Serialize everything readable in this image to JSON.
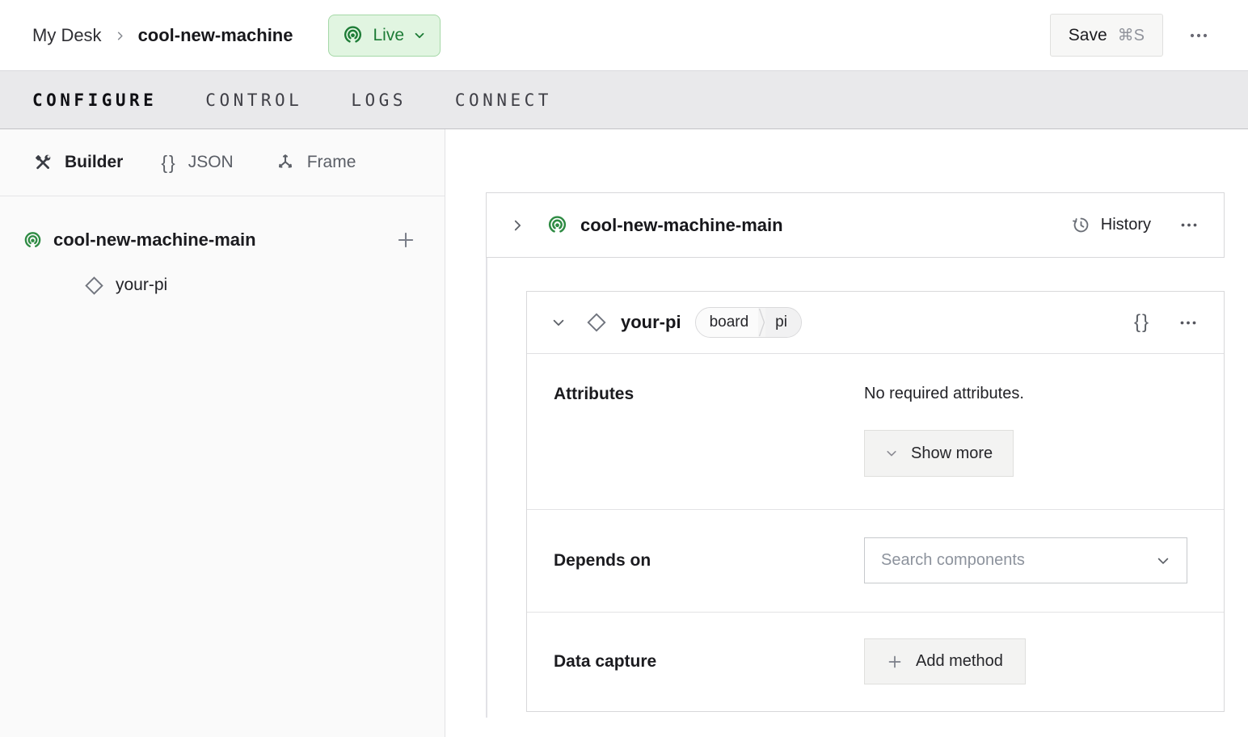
{
  "header": {
    "breadcrumb": {
      "parent": "My Desk",
      "current": "cool-new-machine"
    },
    "status": {
      "label": "Live"
    },
    "save": {
      "label": "Save",
      "shortcut": "⌘S"
    }
  },
  "tabs": [
    {
      "label": "CONFIGURE",
      "active": true
    },
    {
      "label": "CONTROL",
      "active": false
    },
    {
      "label": "LOGS",
      "active": false
    },
    {
      "label": "CONNECT",
      "active": false
    }
  ],
  "sidebar": {
    "view_modes": [
      {
        "label": "Builder",
        "icon": "tools-icon",
        "active": true
      },
      {
        "label": "JSON",
        "icon": "braces-icon",
        "active": false
      },
      {
        "label": "Frame",
        "icon": "frame-axes-icon",
        "active": false
      }
    ],
    "tree": {
      "root": {
        "label": "cool-new-machine-main",
        "icon": "machine-live-icon"
      },
      "children": [
        {
          "label": "your-pi",
          "icon": "component-diamond-icon"
        }
      ]
    }
  },
  "main": {
    "part_card": {
      "title": "cool-new-machine-main",
      "history_label": "History"
    },
    "component_card": {
      "title": "your-pi",
      "type_badge": "board",
      "model_badge": "pi",
      "attributes": {
        "label": "Attributes",
        "empty_text": "No required attributes.",
        "show_more_label": "Show more"
      },
      "depends_on": {
        "label": "Depends on",
        "placeholder": "Search components"
      },
      "data_capture": {
        "label": "Data capture",
        "add_method_label": "Add method"
      }
    }
  },
  "glyphs": {
    "braces": "{}",
    "kebab": "•••"
  },
  "colors": {
    "accent_green": "#2e8b43",
    "status_text": "#1d7c36",
    "status_bg": "#e1f5e1",
    "status_border": "#a5d8a7",
    "tabbar_bg": "#e9e9eb",
    "sidebar_bg": "#fafafa",
    "card_border": "#d8d8da"
  }
}
